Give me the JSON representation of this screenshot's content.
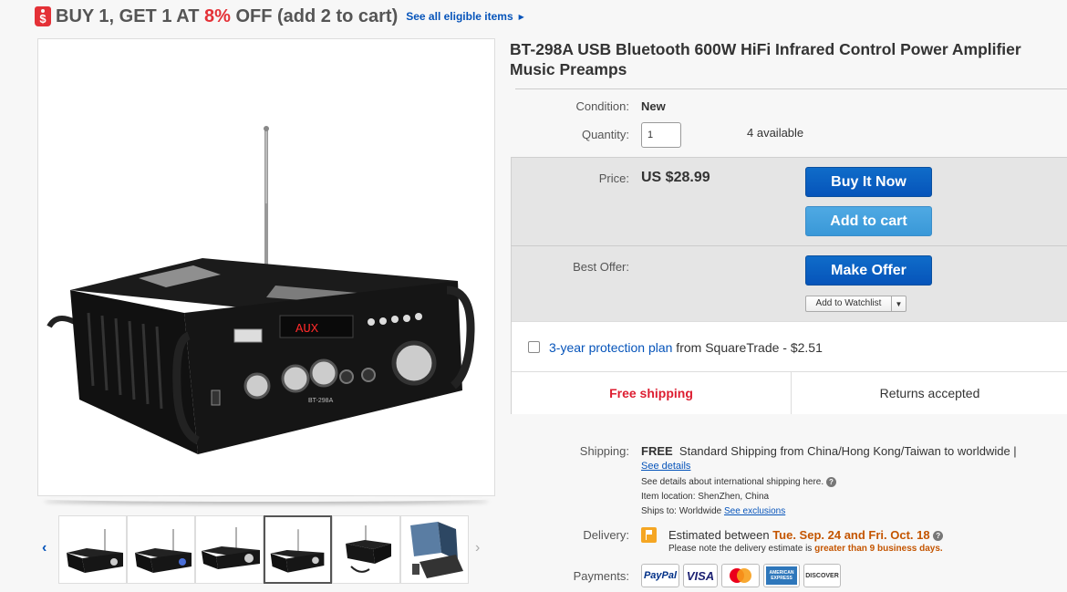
{
  "promo": {
    "tag_symbol": "$",
    "text_before": "BUY 1, GET 1 AT ",
    "percent": "8%",
    "text_after": " OFF (add 2 to cart)",
    "see_all": "See all eligible items",
    "see_all_arrow": "▶"
  },
  "gallery": {
    "prev_arrow": "‹",
    "next_arrow": "›",
    "thumbnail_count": 6,
    "active_index": 3
  },
  "product": {
    "title": "BT-298A USB Bluetooth 600W HiFi Infrared Control Power Amplifier Music Preamps",
    "device_display": "AUX",
    "device_model": "BT-298A"
  },
  "details": {
    "condition_label": "Condition:",
    "condition_value": "New",
    "quantity_label": "Quantity:",
    "quantity_value": "1",
    "available": "4 available"
  },
  "purchase": {
    "price_label": "Price:",
    "price_value": "US $28.99",
    "buy_now": "Buy It Now",
    "add_to_cart": "Add to cart",
    "best_offer_label": "Best Offer:",
    "make_offer": "Make Offer",
    "watchlist": "Add to Watchlist",
    "watchlist_arrow": "▼"
  },
  "protection": {
    "link": "3-year protection plan",
    "rest": " from SquareTrade - $2.51"
  },
  "badges": {
    "free_shipping": "Free shipping",
    "returns": "Returns accepted"
  },
  "shipping": {
    "label": "Shipping:",
    "free": "FREE",
    "method": "Standard Shipping from China/Hong Kong/Taiwan to worldwide |",
    "see_details": "See details",
    "intl_note": "See details about international shipping here.",
    "location": "Item location:  ShenZhen, China",
    "ships_to_prefix": "Ships to:  Worldwide  ",
    "see_exclusions": "See exclusions"
  },
  "delivery": {
    "label": "Delivery:",
    "estimated_prefix": "Estimated between ",
    "dates": "Tue. Sep. 24 and Fri. Oct. 18",
    "note_prefix": "Please note the delivery estimate is ",
    "note_emphasis": "greater than 9 business days."
  },
  "payments": {
    "label": "Payments:",
    "methods": [
      "PayPal",
      "VISA",
      "",
      "AMERICAN EXPRESS",
      "DISCOVER"
    ]
  },
  "colors": {
    "accent_red": "#e43137",
    "link_blue": "#0654ba",
    "button_blue": "#0654ba",
    "button_light_blue": "#3998d8",
    "free_shipping_red": "#dd1e31",
    "delivery_orange": "#c45500"
  }
}
